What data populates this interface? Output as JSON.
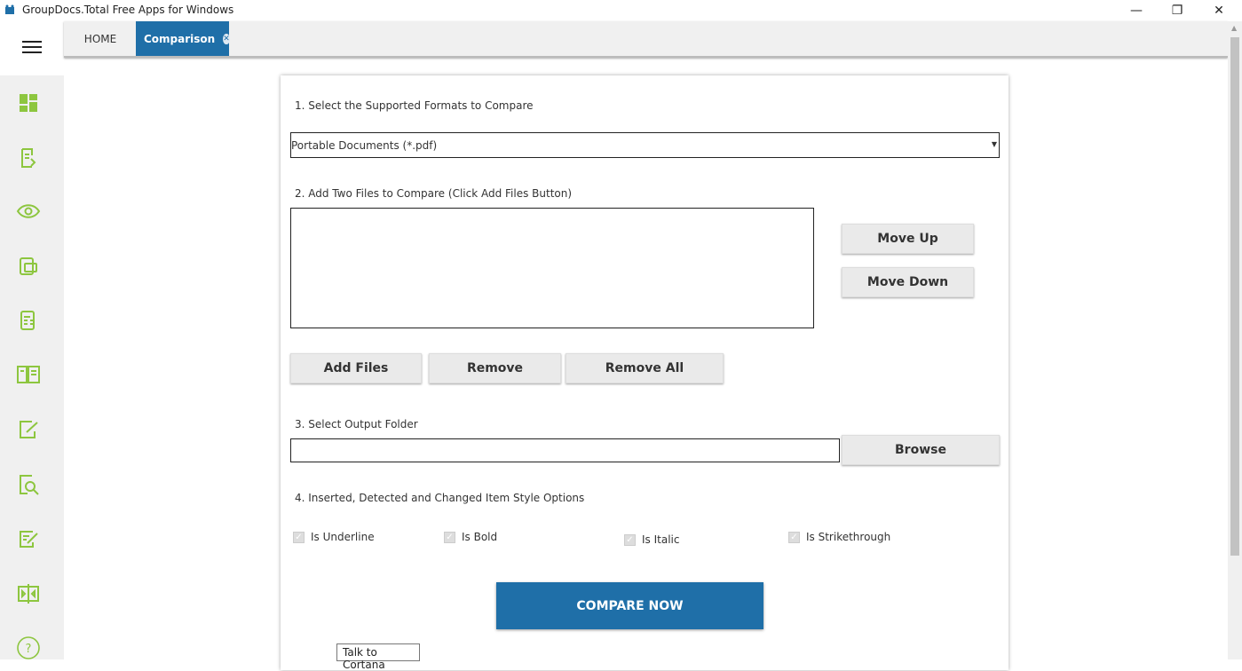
{
  "window": {
    "title": "GroupDocs.Total Free Apps for Windows",
    "minimize": "—",
    "restore": "❐",
    "close": "✕"
  },
  "tabs": [
    {
      "label": "HOME"
    },
    {
      "label": "Comparison",
      "close": "✕"
    }
  ],
  "sidebar": {
    "icons": [
      "dashboard-icon",
      "document-convert-icon",
      "viewer-eye-icon",
      "document-merge-icon",
      "document-parser-icon",
      "document-split-icon",
      "document-edit-icon",
      "document-search-icon",
      "document-annotate-icon",
      "document-compare-icon",
      "help-icon"
    ],
    "accent": "#8dc63f"
  },
  "form": {
    "step1": "1. Select the Supported Formats to Compare",
    "format_selected": "Portable Documents (*.pdf)",
    "step2": "2. Add Two Files to Compare (Click Add Files Button)",
    "move_up": "Move Up",
    "move_down": "Move Down",
    "add_files": "Add Files",
    "remove": "Remove",
    "remove_all": "Remove All",
    "step3": "3. Select Output Folder",
    "output_folder": "",
    "browse": "Browse",
    "step4": "4. Inserted, Detected and Changed Item Style Options",
    "options": [
      {
        "label": "Is Underline",
        "checked": true
      },
      {
        "label": "Is Bold",
        "checked": true
      },
      {
        "label": "Is Italic",
        "checked": true
      },
      {
        "label": "Is Strikethrough",
        "checked": true
      }
    ],
    "compare": "COMPARE NOW"
  },
  "tooltip": "Talk to Cortana",
  "colors": {
    "primary": "#1f6fa8",
    "accent": "#8dc63f"
  }
}
